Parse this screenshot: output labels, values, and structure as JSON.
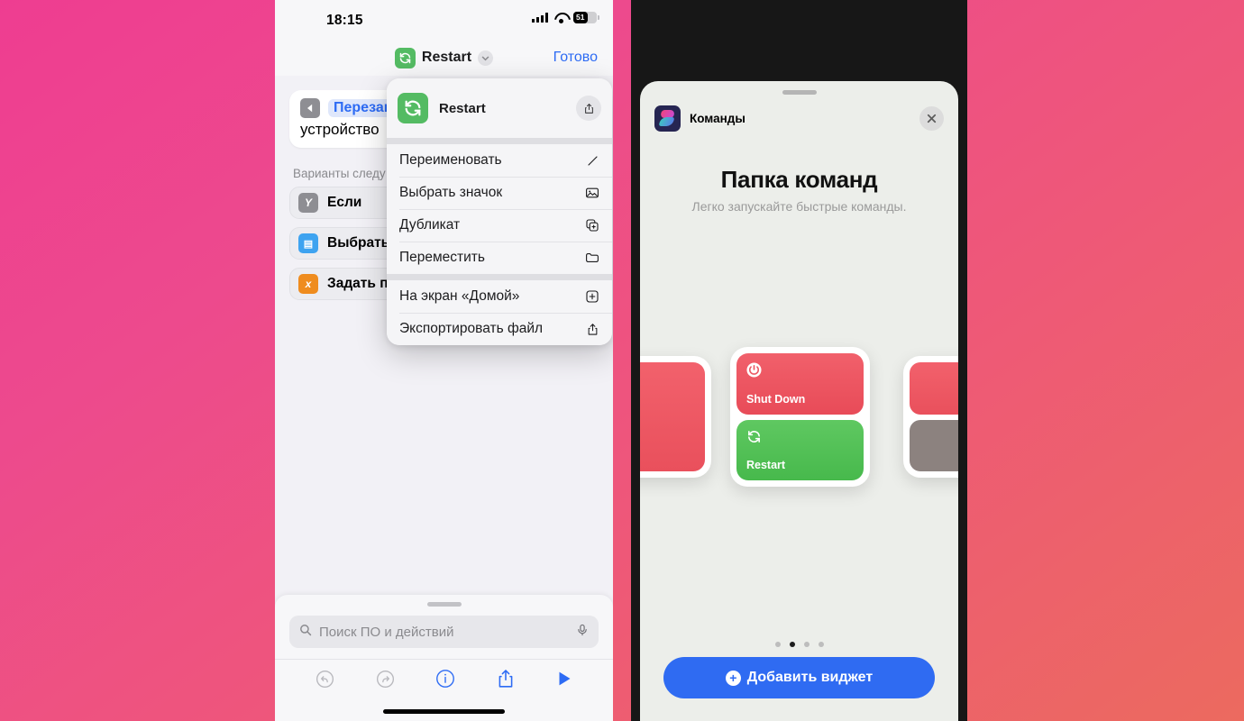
{
  "colors": {
    "bg_top": "#ee3d91",
    "bg_bottom": "#ec6a5f",
    "accent_blue": "#2d6bf4",
    "shortcut_green": "#54bb63",
    "tile_red": "#e84b58",
    "tile_green": "#47b94c",
    "add_button_blue": "#2f6bf2"
  },
  "left_phone": {
    "status_bar": {
      "time": "18:15",
      "battery_percent": "51",
      "signal_icon": "cellular-signal-icon",
      "wifi_icon": "wifi-icon",
      "battery_icon": "battery-icon"
    },
    "navbar": {
      "shortcut_icon": "restart-shortcut-icon",
      "title": "Restart",
      "chevron_icon": "chevron-down-icon",
      "done_label": "Готово"
    },
    "editor": {
      "action_card": {
        "badge_icon": "back-action-icon",
        "token_text": "Перезаг",
        "second_line": "устройство"
      },
      "section_label": "Варианты следу",
      "suggestions": [
        {
          "label": "Если",
          "icon": "if-icon",
          "glyph": "Y",
          "color": "#8e8e93"
        },
        {
          "label": "Выбрать из",
          "icon": "choose-from-menu-icon",
          "glyph": "▤",
          "color": "#3ea3f0"
        },
        {
          "label": "Задать пер",
          "icon": "set-variable-icon",
          "glyph": "x",
          "color": "#ef8c1e"
        }
      ]
    },
    "context_menu": {
      "header": {
        "icon": "restart-shortcut-icon",
        "title": "Restart",
        "share_button_icon": "share-icon"
      },
      "group1": [
        {
          "label": "Переименовать",
          "icon": "pencil-icon"
        },
        {
          "label": "Выбрать значок",
          "icon": "photo-icon"
        },
        {
          "label": "Дубликат",
          "icon": "duplicate-icon"
        },
        {
          "label": "Переместить",
          "icon": "folder-icon"
        }
      ],
      "group2": [
        {
          "label": "На экран «Домой»",
          "icon": "add-to-home-icon"
        },
        {
          "label": "Экспортировать файл",
          "icon": "export-icon"
        }
      ]
    },
    "bottom_panel": {
      "grabber_icon": "sheet-grabber",
      "search": {
        "placeholder": "Поиск ПО и действий",
        "search_icon": "search-icon",
        "mic_icon": "microphone-icon"
      },
      "toolbar": [
        {
          "name": "undo-button",
          "icon": "undo-icon",
          "enabled": false
        },
        {
          "name": "redo-button",
          "icon": "redo-icon",
          "enabled": false
        },
        {
          "name": "info-button",
          "icon": "info-icon",
          "enabled": true
        },
        {
          "name": "share-button",
          "icon": "share-icon",
          "enabled": true
        },
        {
          "name": "play-button",
          "icon": "play-icon",
          "enabled": true
        }
      ]
    }
  },
  "right_phone": {
    "sheet": {
      "grabber_icon": "sheet-grabber",
      "app_icon": "shortcuts-app-icon",
      "app_name": "Команды",
      "close_icon": "close-icon",
      "title": "Папка команд",
      "subtitle": "Легко запускайте быстрые команды."
    },
    "widget_preview": {
      "tiles": [
        {
          "label": "Shut Down",
          "icon": "power-icon",
          "color": "#e84b58"
        },
        {
          "label": "Restart",
          "icon": "restart-icon",
          "color": "#47b94c"
        }
      ]
    },
    "pagination": {
      "total": 4,
      "active_index": 1
    },
    "add_button": {
      "label": "Добавить виджет",
      "icon": "plus-circle-icon"
    }
  }
}
